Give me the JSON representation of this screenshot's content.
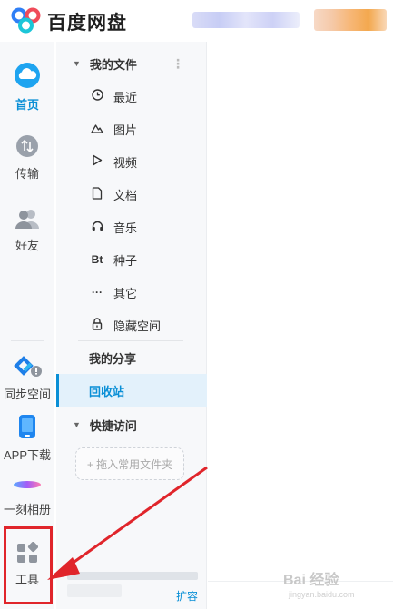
{
  "app": {
    "title": "百度网盘"
  },
  "rail": {
    "home": "首页",
    "transfer": "传输",
    "friends": "好友",
    "sync": "同步空间",
    "app_download": "APP下载",
    "moment": "一刻相册",
    "tools": "工具"
  },
  "nav": {
    "my_files": "我的文件",
    "items": [
      {
        "label": "最近",
        "icon": "clock-icon"
      },
      {
        "label": "图片",
        "icon": "mountain-icon"
      },
      {
        "label": "视频",
        "icon": "play-icon"
      },
      {
        "label": "文档",
        "icon": "document-icon"
      },
      {
        "label": "音乐",
        "icon": "headphones-icon"
      },
      {
        "label": "种子",
        "icon": "bt-icon",
        "glyph": "Bt"
      },
      {
        "label": "其它",
        "icon": "more-icon"
      },
      {
        "label": "隐藏空间",
        "icon": "lock-icon"
      }
    ],
    "my_share": "我的分享",
    "recycle": "回收站",
    "quick_access": "快捷访问",
    "drop_placeholder": "+ 拖入常用文件夹",
    "expand": "扩容"
  },
  "watermark": {
    "text": "Bai 经验",
    "sub": "jingyan.baidu.com"
  },
  "colors": {
    "accent": "#0a8fd6",
    "annotation": "#e0252b"
  }
}
